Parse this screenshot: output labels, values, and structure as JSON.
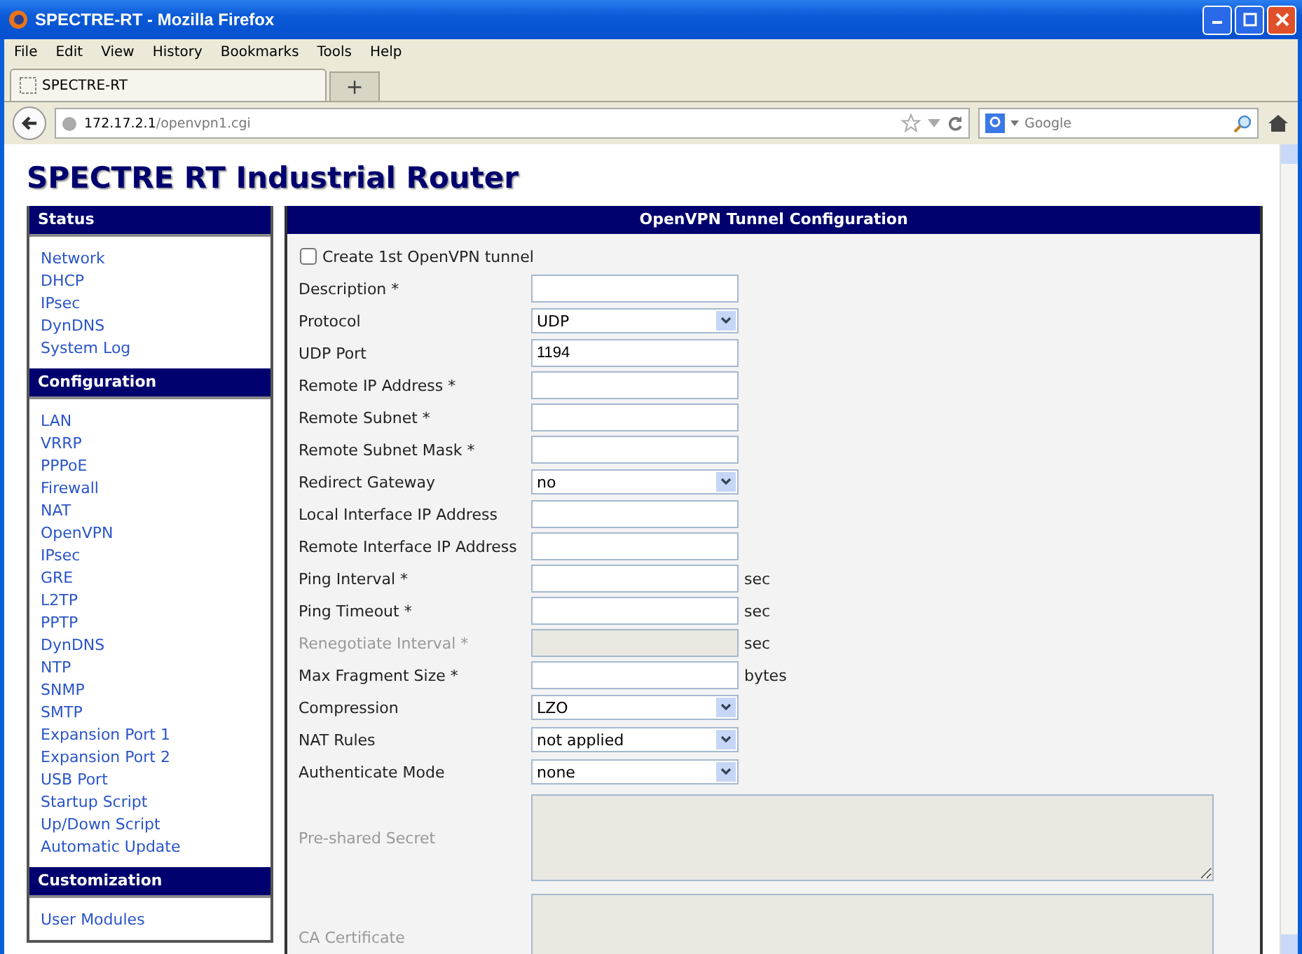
{
  "window": {
    "title": "SPECTRE-RT - Mozilla Firefox"
  },
  "menu": [
    "File",
    "Edit",
    "View",
    "History",
    "Bookmarks",
    "Tools",
    "Help"
  ],
  "tabs": [
    {
      "label": "SPECTRE-RT",
      "selected": true
    }
  ],
  "new_tab": "+",
  "address": {
    "host": "172.17.2.1",
    "path": "/openvpn1.cgi"
  },
  "search": {
    "placeholder": "Google"
  },
  "page_title": "SPECTRE RT Industrial Router",
  "sidebar": [
    {
      "title": "Status",
      "items": [
        "Network",
        "DHCP",
        "IPsec",
        "DynDNS",
        "System Log"
      ]
    },
    {
      "title": "Configuration",
      "items": [
        "LAN",
        "VRRP",
        "PPPoE",
        "Firewall",
        "NAT",
        "OpenVPN",
        "IPsec",
        "GRE",
        "L2TP",
        "PPTP",
        "DynDNS",
        "NTP",
        "SNMP",
        "SMTP",
        "Expansion Port 1",
        "Expansion Port 2",
        "USB Port",
        "Startup Script",
        "Up/Down Script",
        "Automatic Update"
      ]
    },
    {
      "title": "Customization",
      "items": [
        "User Modules"
      ]
    }
  ],
  "panel": {
    "title": "OpenVPN Tunnel Configuration",
    "rows": [
      {
        "kind": "checkbox",
        "label": "Create 1st OpenVPN tunnel",
        "checked": false
      },
      {
        "kind": "text",
        "label": "Description *",
        "disabled": false
      },
      {
        "kind": "select",
        "label": "Protocol",
        "value": "UDP"
      },
      {
        "kind": "text",
        "label": "UDP Port",
        "value": "1194",
        "disabled": false
      },
      {
        "kind": "text",
        "label": "Remote IP Address *",
        "disabled": false
      },
      {
        "kind": "text",
        "label": "Remote Subnet *",
        "disabled": false
      },
      {
        "kind": "text",
        "label": "Remote Subnet Mask *",
        "disabled": false
      },
      {
        "kind": "select",
        "label": "Redirect Gateway",
        "value": "no"
      },
      {
        "kind": "text",
        "label": "Local Interface IP Address",
        "disabled": false
      },
      {
        "kind": "text",
        "label": "Remote Interface IP Address",
        "disabled": false
      },
      {
        "kind": "text",
        "label": "Ping Interval *",
        "unit": "sec",
        "disabled": false
      },
      {
        "kind": "text",
        "label": "Ping Timeout *",
        "unit": "sec",
        "disabled": false
      },
      {
        "kind": "text",
        "label": "Renegotiate Interval *",
        "unit": "sec",
        "disabled": true
      },
      {
        "kind": "text",
        "label": "Max Fragment Size *",
        "unit": "bytes",
        "disabled": false
      },
      {
        "kind": "select",
        "label": "Compression",
        "value": "LZO"
      },
      {
        "kind": "select",
        "label": "NAT Rules",
        "value": "not applied"
      },
      {
        "kind": "select",
        "label": "Authenticate Mode",
        "value": "none"
      },
      {
        "kind": "textarea",
        "label": "Pre-shared Secret",
        "disabled": true
      },
      {
        "kind": "textarea",
        "label": "CA Certificate",
        "disabled": true
      }
    ]
  }
}
